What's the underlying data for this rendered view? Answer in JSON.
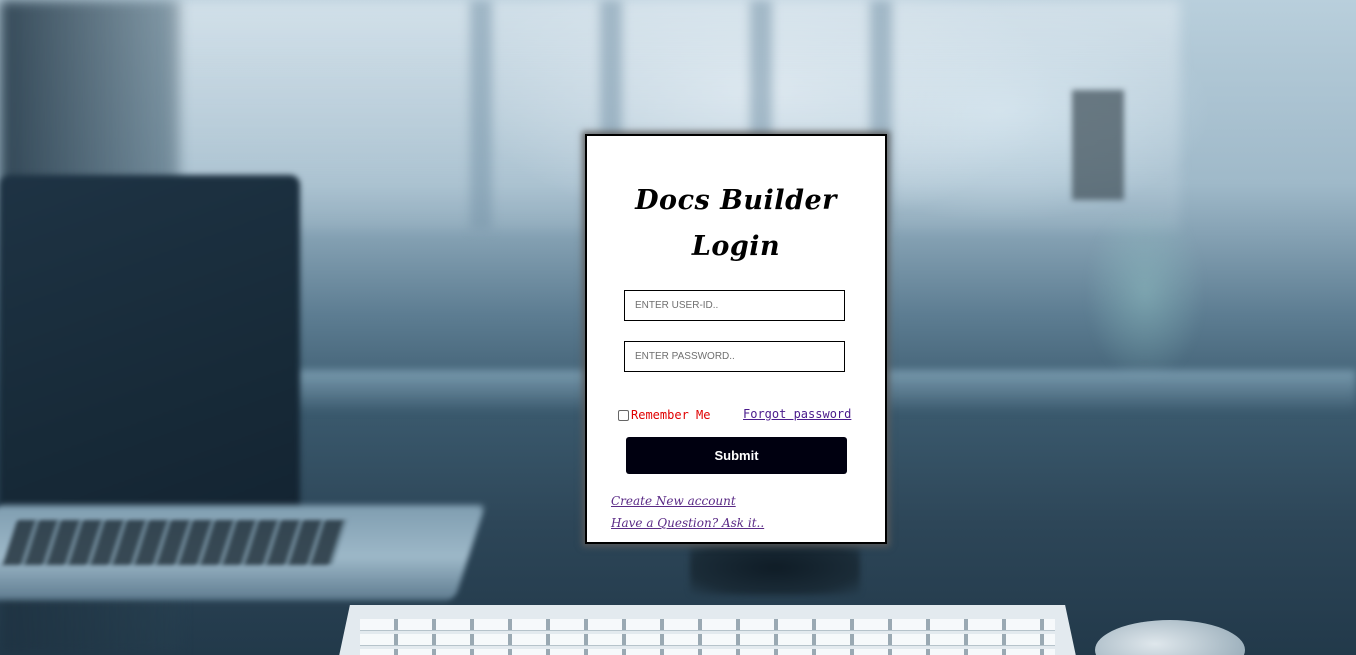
{
  "login_card": {
    "title_line1": "Docs Builder",
    "title_line2": "Login",
    "userid_placeholder": "ENTER USER-ID..",
    "password_placeholder": "ENTER PASSWORD..",
    "remember_label": "Remember Me",
    "remember_checked": false,
    "forgot_label": "Forgot password",
    "submit_label": "Submit",
    "create_account_label": "Create New account",
    "question_label": "Have a Question? Ask it.."
  },
  "colors": {
    "card_background": "#ffffff",
    "card_border": "#000000",
    "submit_background": "#000010",
    "remember_text": "#e00000",
    "link_text": "#4a1b8c"
  }
}
